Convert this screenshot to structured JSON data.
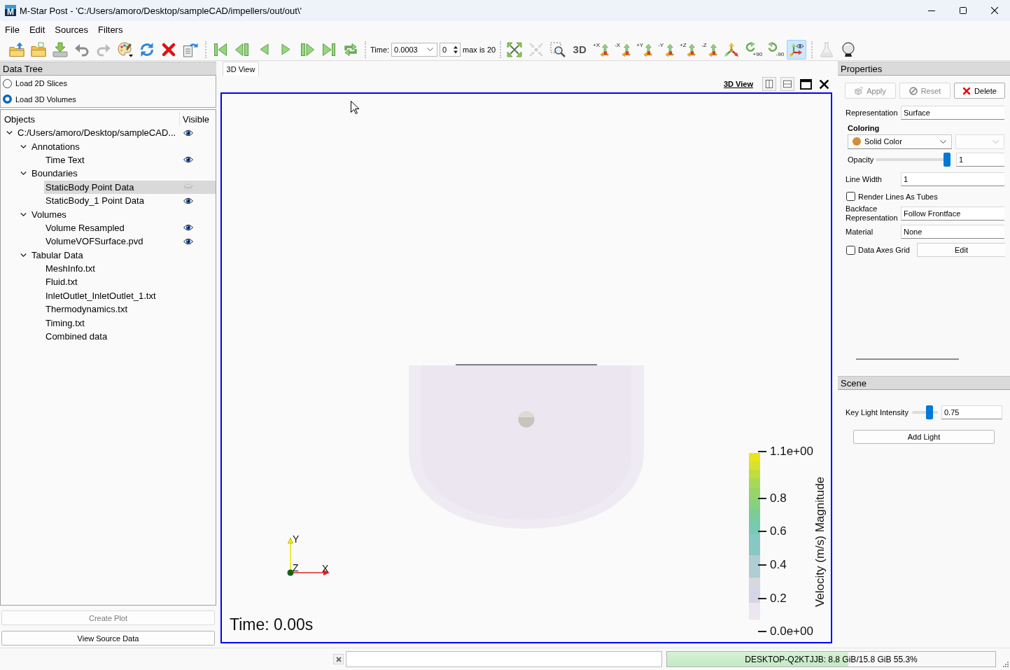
{
  "window": {
    "logo": "M",
    "title": "M-Star Post - 'C:/Users/amoro/Desktop/sampleCAD/impellers/out/out\\'"
  },
  "menu": [
    "File",
    "Edit",
    "Sources",
    "Filters"
  ],
  "toolbar": {
    "file_tools": [
      {
        "kind": "open-file",
        "disabled": false,
        "on": false
      },
      {
        "kind": "open-folder",
        "disabled": false,
        "on": false
      },
      {
        "kind": "load",
        "disabled": false,
        "on": false
      },
      {
        "kind": "undo",
        "disabled": false,
        "on": false
      },
      {
        "kind": "redo",
        "disabled": true,
        "on": false
      },
      {
        "kind": "palette",
        "disabled": false,
        "on": false
      },
      {
        "kind": "reload",
        "disabled": false,
        "on": false
      },
      {
        "kind": "delete",
        "disabled": false,
        "on": false
      },
      {
        "kind": "reload-doc",
        "disabled": false,
        "on": false
      }
    ],
    "playback": [
      {
        "kind": "first",
        "disabled": false,
        "on": false
      },
      {
        "kind": "step-back",
        "disabled": false,
        "on": false
      },
      {
        "kind": "reverse",
        "disabled": false,
        "on": false
      },
      {
        "kind": "play",
        "disabled": false,
        "on": false
      },
      {
        "kind": "step-forward",
        "disabled": false,
        "on": false
      },
      {
        "kind": "last",
        "disabled": false,
        "on": false
      },
      {
        "kind": "loop",
        "disabled": false,
        "on": false
      }
    ],
    "time": {
      "label": "Time:",
      "value": "0.0003",
      "index": "0",
      "max": "max is 20"
    },
    "view_tools": [
      {
        "kind": "reset-camera",
        "disabled": false,
        "on": false
      },
      {
        "kind": "zoom-data",
        "disabled": true,
        "on": false
      },
      {
        "kind": "zoom-box",
        "disabled": false,
        "on": false
      },
      {
        "kind": "mode",
        "label": "3D",
        "disabled": false,
        "on": false
      },
      {
        "kind": "axis",
        "label": "+X",
        "disabled": false,
        "on": false
      },
      {
        "kind": "axis",
        "label": "-X",
        "disabled": false,
        "on": false
      },
      {
        "kind": "axis",
        "label": "+Y",
        "disabled": false,
        "on": false
      },
      {
        "kind": "axis",
        "label": "-Y",
        "disabled": false,
        "on": false
      },
      {
        "kind": "axis",
        "label": "+Z",
        "disabled": false,
        "on": false
      },
      {
        "kind": "axis",
        "label": "-Z",
        "disabled": false,
        "on": false
      },
      {
        "kind": "iso",
        "disabled": false,
        "on": false
      },
      {
        "kind": "rotate-cw",
        "label": "+90",
        "disabled": false,
        "on": false
      },
      {
        "kind": "rotate-ccw",
        "label": "-90",
        "disabled": false,
        "on": false
      },
      {
        "kind": "interact",
        "disabled": false,
        "on": true
      }
    ],
    "extra_tools": [
      {
        "kind": "flask",
        "disabled": true,
        "on": false
      },
      {
        "kind": "globe",
        "disabled": false,
        "on": false
      }
    ]
  },
  "data_tree": {
    "title": "Data Tree",
    "sources": [
      {
        "label": "Load 2D Slices",
        "selected": false
      },
      {
        "label": "Load 3D Volumes",
        "selected": true
      }
    ],
    "columns": [
      "Objects",
      "Visible"
    ],
    "items": [
      {
        "label": "C:/Users/amoro/Desktop/sampleCAD...",
        "selected": false,
        "expanded": true,
        "visible": true,
        "children": [
          {
            "label": "Annotations",
            "selected": false,
            "expanded": true,
            "children": [
              {
                "label": "Time Text",
                "selected": false,
                "visible": true
              }
            ]
          },
          {
            "label": "Boundaries",
            "selected": false,
            "expanded": true,
            "children": [
              {
                "label": "StaticBody Point Data",
                "selected": true,
                "visible": false
              },
              {
                "label": "StaticBody_1 Point Data",
                "selected": false,
                "visible": true
              }
            ]
          },
          {
            "label": "Volumes",
            "selected": false,
            "expanded": true,
            "children": [
              {
                "label": "Volume Resampled",
                "selected": false,
                "visible": true
              },
              {
                "label": "VolumeVOFSurface.pvd",
                "selected": false,
                "visible": true
              }
            ]
          },
          {
            "label": "Tabular Data",
            "selected": false,
            "expanded": true,
            "children": [
              {
                "label": "MeshInfo.txt",
                "selected": false
              },
              {
                "label": "Fluid.txt",
                "selected": false
              },
              {
                "label": "InletOutlet_InletOutlet_1.txt",
                "selected": false
              },
              {
                "label": "Thermodynamics.txt",
                "selected": false
              },
              {
                "label": "Timing.txt",
                "selected": false
              },
              {
                "label": "Combined data",
                "selected": false
              }
            ]
          }
        ]
      }
    ],
    "actions": [
      {
        "label": "Create Plot",
        "disabled": true
      },
      {
        "label": "View Source Data",
        "disabled": false
      }
    ]
  },
  "view": {
    "tabs": [
      {
        "label": "3D View",
        "selected": true
      }
    ],
    "header": "3D View",
    "scene": {
      "axes": {
        "x": "X",
        "y": "Y",
        "z": "Z"
      },
      "time_text": "Time: 0.00s",
      "legend": {
        "title": "Velocity (m/s) Magnitude",
        "ticks": [
          "1.1e+00",
          "0.8",
          "0.6",
          "0.4",
          "0.2",
          "0.0e+00"
        ]
      }
    }
  },
  "properties": {
    "title": "Properties",
    "actions": [
      {
        "kind": "apply",
        "label": "Apply",
        "disabled": true
      },
      {
        "kind": "reset",
        "label": "Reset",
        "disabled": true
      },
      {
        "kind": "delete",
        "label": "Delete",
        "disabled": false
      }
    ],
    "rows": [
      {
        "kind": "field",
        "label": "Representation",
        "value": "Surface"
      },
      {
        "kind": "heading",
        "label": "Coloring"
      },
      {
        "kind": "combos",
        "value": "Solid Color"
      },
      {
        "kind": "slider",
        "label": "Opacity",
        "level": 1,
        "value": "1"
      },
      {
        "kind": "field",
        "label": "Line Width",
        "value": "1"
      },
      {
        "kind": "checkbox",
        "label": "Render Lines As Tubes",
        "checked": false
      },
      {
        "kind": "field",
        "label": "Backface Representation",
        "value": "Follow Frontface"
      },
      {
        "kind": "field",
        "label": "Material",
        "value": "None"
      },
      {
        "kind": "checkbox-button",
        "label": "Data Axes Grid",
        "checked": false,
        "button": "Edit"
      }
    ]
  },
  "scene": {
    "title": "Scene",
    "rows": [
      {
        "kind": "slider",
        "label": "Key Light Intensity",
        "level": 0.75,
        "value": "0.75"
      },
      {
        "kind": "button",
        "label": "Add Light"
      }
    ]
  },
  "status_bar": {
    "memory": {
      "level": 0.553,
      "text": "DESKTOP-Q2KTJJB: 8.8 GiB/15.8 GiB 55.3%"
    }
  }
}
